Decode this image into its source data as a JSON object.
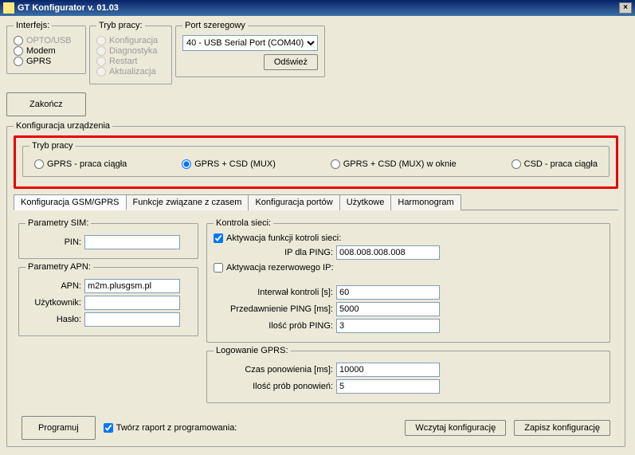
{
  "title": "GT Konfigurator v. 01.03",
  "close_glyph": "×",
  "interfejs": {
    "legend": "Interfejs:",
    "opto_usb": "OPTO/USB",
    "modem": "Modem",
    "gprs": "GPRS"
  },
  "tryb_pracy_top": {
    "legend": "Tryb pracy:",
    "konfiguracja": "Konfiguracja",
    "diagnostyka": "Diagnostyka",
    "restart": "Restart",
    "aktualizacja": "Aktualizacja"
  },
  "port": {
    "legend": "Port szeregowy",
    "selected": "40 - USB Serial Port (COM40)",
    "refresh": "Odśwież"
  },
  "zakoncz": "Zakończ",
  "config_device": {
    "legend": "Konfiguracja urządzenia",
    "tryb_pracy_legend": "Tryb pracy",
    "modes": {
      "gprs_ciagla": "GPRS - praca ciągła",
      "gprs_csd_mux": "GPRS + CSD (MUX)",
      "gprs_csd_okno": "GPRS + CSD (MUX) w oknie",
      "csd_ciagla": "CSD - praca ciągła"
    }
  },
  "tabs": {
    "gsm": "Konfiguracja GSM/GPRS",
    "czas": "Funkcje związane z czasem",
    "porty": "Konfiguracja portów",
    "uzytkowe": "Użytkowe",
    "harmonogram": "Harmonogram"
  },
  "sim": {
    "legend": "Parametry SIM:",
    "pin_label": "PIN:",
    "pin": ""
  },
  "apn": {
    "legend": "Parametry APN:",
    "apn_label": "APN:",
    "apn": "m2m.plusgsm.pl",
    "user_label": "Użytkownik:",
    "user": "",
    "pass_label": "Hasło:",
    "pass": ""
  },
  "kontrola": {
    "legend": "Kontrola sieci:",
    "aktywacja": "Aktywacja funkcji kotroli sieci:",
    "ip_ping_label": "IP dla PING:",
    "ip_ping": "008.008.008.008",
    "rezerwowy": "Aktywacja rezerwowego IP:",
    "interwal_label": "Interwał kontroli [s]:",
    "interwal": "60",
    "przedawnienie_label": "Przedawnienie PING [ms]:",
    "przedawnienie": "5000",
    "ilosc_prob_label": "Ilość prób PING:",
    "ilosc_prob": "3"
  },
  "logowanie": {
    "legend": "Logowanie GPRS:",
    "czas_label": "Czas ponowienia [ms]:",
    "czas": "10000",
    "ilosc_label": "Ilość prób ponowień:",
    "ilosc": "5"
  },
  "bottom": {
    "programuj": "Programuj",
    "raport": "Twórz raport z programowania:",
    "wczytaj": "Wczytaj konfigurację",
    "zapisz": "Zapisz konfigurację"
  }
}
